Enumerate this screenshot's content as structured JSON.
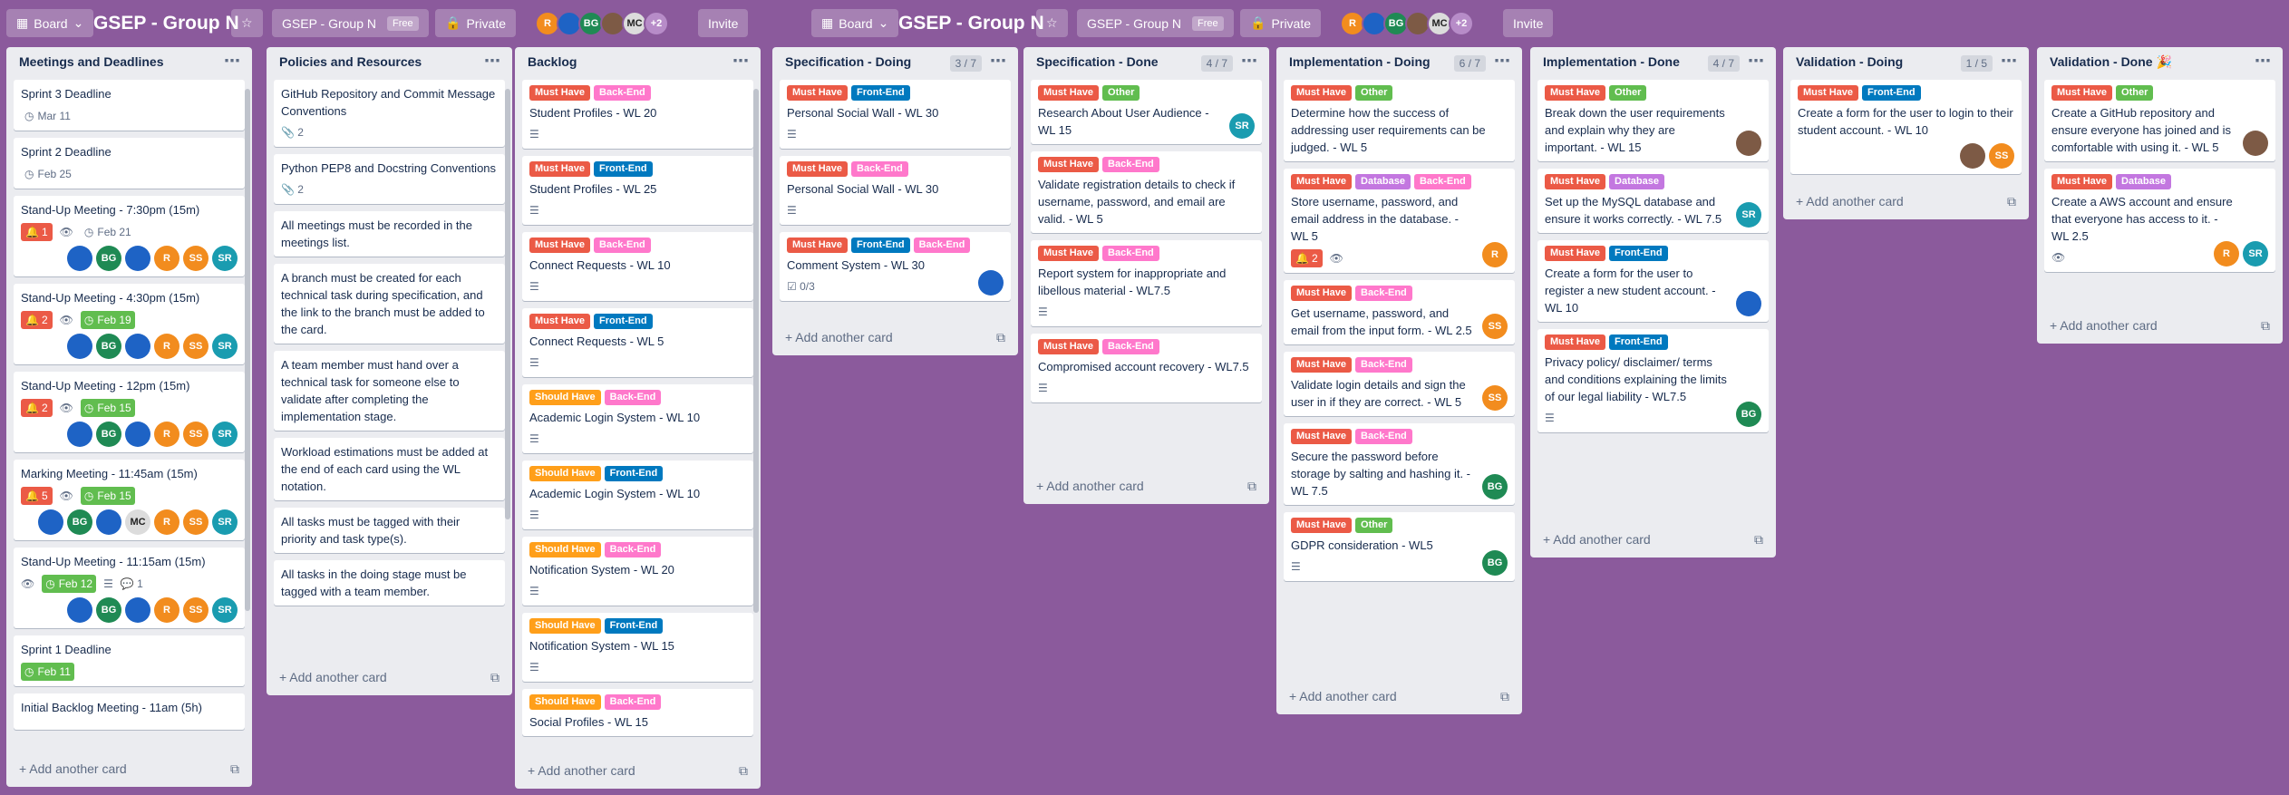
{
  "board": {
    "board_btn": "Board",
    "title": "GSEP - Group N",
    "star_icon": "☆",
    "team": "GSEP - Group N",
    "free": "Free",
    "visibility": "Private",
    "invite": "Invite",
    "more_members": "+2",
    "members": [
      {
        "initials": "R",
        "color": "c-o"
      },
      {
        "initials": "",
        "color": "c-b"
      },
      {
        "initials": "BG",
        "color": "c-g"
      },
      {
        "initials": "",
        "color": "c-p"
      },
      {
        "initials": "MC",
        "color": "c-m"
      }
    ]
  },
  "lists": [
    {
      "title": "Meetings and Deadlines",
      "count": "",
      "add": "Add another card",
      "cards": [
        {
          "title": "Sprint 3 Deadline",
          "badges": [
            {
              "type": "date",
              "text": "Mar 11",
              "style": "plain"
            }
          ]
        },
        {
          "title": "Sprint 2 Deadline",
          "badges": [
            {
              "type": "date",
              "text": "Feb 25",
              "style": "plain"
            }
          ]
        },
        {
          "title": "Stand-Up Meeting - 7:30pm (15m)",
          "badges": [
            {
              "type": "notif",
              "text": "1"
            },
            {
              "type": "watch"
            },
            {
              "type": "date",
              "text": "Feb 21",
              "style": "plain"
            }
          ],
          "members": [
            "",
            "BG",
            "",
            "R",
            "SS",
            "SR"
          ]
        },
        {
          "title": "Stand-Up Meeting - 4:30pm (15m)",
          "badges": [
            {
              "type": "notif",
              "text": "2"
            },
            {
              "type": "watch"
            },
            {
              "type": "date",
              "text": "Feb 19",
              "style": "green"
            }
          ],
          "members": [
            "",
            "BG",
            "",
            "R",
            "SS",
            "SR"
          ]
        },
        {
          "title": "Stand-Up Meeting - 12pm (15m)",
          "badges": [
            {
              "type": "notif",
              "text": "2"
            },
            {
              "type": "watch"
            },
            {
              "type": "date",
              "text": "Feb 15",
              "style": "green"
            }
          ],
          "members": [
            "",
            "BG",
            "",
            "R",
            "SS",
            "SR"
          ]
        },
        {
          "title": "Marking Meeting - 11:45am (15m)",
          "badges": [
            {
              "type": "notif",
              "text": "5"
            },
            {
              "type": "watch"
            },
            {
              "type": "date",
              "text": "Feb 15",
              "style": "green"
            }
          ],
          "members": [
            "",
            "BG",
            "",
            "MC",
            "R",
            "SS",
            "SR"
          ]
        },
        {
          "title": "Stand-Up Meeting - 11:15am (15m)",
          "badges": [
            {
              "type": "watch"
            },
            {
              "type": "date",
              "text": "Feb 12",
              "style": "green"
            },
            {
              "type": "desc"
            },
            {
              "type": "comment",
              "text": "1"
            }
          ],
          "members": [
            "",
            "BG",
            "",
            "R",
            "SS",
            "SR"
          ]
        },
        {
          "title": "Sprint 1 Deadline",
          "badges": [
            {
              "type": "date",
              "text": "Feb 11",
              "style": "green"
            }
          ]
        },
        {
          "title": "Initial Backlog Meeting - 11am (5h)",
          "badges": []
        }
      ]
    },
    {
      "title": "Policies and Resources",
      "count": "",
      "add": "Add another card",
      "cards": [
        {
          "title": "GitHub Repository and Commit Message Conventions",
          "badges": [
            {
              "type": "attach",
              "text": "2"
            }
          ]
        },
        {
          "title": "Python PEP8 and Docstring Conventions",
          "badges": [
            {
              "type": "attach",
              "text": "2"
            }
          ]
        },
        {
          "title": "All meetings must be recorded in the meetings list.",
          "badges": []
        },
        {
          "title": "A branch must be created for each technical task during specification, and the link to the branch must be added to the card.",
          "badges": []
        },
        {
          "title": "A team member must hand over a technical task for someone else to validate after completing the implementation stage.",
          "badges": []
        },
        {
          "title": "Workload estimations must be added at the end of each card using the WL notation.",
          "badges": []
        },
        {
          "title": "All tasks must be tagged with their priority and task type(s).",
          "badges": []
        },
        {
          "title": "All tasks in the doing stage must be tagged with a team member.",
          "badges": []
        }
      ]
    },
    {
      "title": "Backlog",
      "count": "",
      "add": "Add another card",
      "cards": [
        {
          "labels": [
            [
              "Must Have",
              "l-red"
            ],
            [
              "Back-End",
              "l-pink"
            ]
          ],
          "title": "Student Profiles - WL 20",
          "badges": [
            {
              "type": "desc"
            }
          ]
        },
        {
          "labels": [
            [
              "Must Have",
              "l-red"
            ],
            [
              "Front-End",
              "l-blue"
            ]
          ],
          "title": "Student Profiles - WL 25",
          "badges": [
            {
              "type": "desc"
            }
          ]
        },
        {
          "labels": [
            [
              "Must Have",
              "l-red"
            ],
            [
              "Back-End",
              "l-pink"
            ]
          ],
          "title": "Connect Requests - WL 10",
          "badges": [
            {
              "type": "desc"
            }
          ]
        },
        {
          "labels": [
            [
              "Must Have",
              "l-red"
            ],
            [
              "Front-End",
              "l-blue"
            ]
          ],
          "title": "Connect Requests - WL 5",
          "badges": [
            {
              "type": "desc"
            }
          ]
        },
        {
          "labels": [
            [
              "Should Have",
              "l-orange"
            ],
            [
              "Back-End",
              "l-pink"
            ]
          ],
          "title": "Academic Login System - WL 10",
          "badges": [
            {
              "type": "desc"
            }
          ]
        },
        {
          "labels": [
            [
              "Should Have",
              "l-orange"
            ],
            [
              "Front-End",
              "l-blue"
            ]
          ],
          "title": "Academic Login System - WL 10",
          "badges": [
            {
              "type": "desc"
            }
          ]
        },
        {
          "labels": [
            [
              "Should Have",
              "l-orange"
            ],
            [
              "Back-End",
              "l-pink"
            ]
          ],
          "title": "Notification System - WL 20",
          "badges": [
            {
              "type": "desc"
            }
          ]
        },
        {
          "labels": [
            [
              "Should Have",
              "l-orange"
            ],
            [
              "Front-End",
              "l-blue"
            ]
          ],
          "title": "Notification System - WL 15",
          "badges": [
            {
              "type": "desc"
            }
          ]
        },
        {
          "labels": [
            [
              "Should Have",
              "l-orange"
            ],
            [
              "Back-End",
              "l-pink"
            ]
          ],
          "title": "Social Profiles - WL 15",
          "badges": []
        }
      ]
    },
    {
      "title": "Specification - Doing",
      "count": "3 / 7",
      "add": "Add another card",
      "cards": [
        {
          "labels": [
            [
              "Must Have",
              "l-red"
            ],
            [
              "Front-End",
              "l-blue"
            ]
          ],
          "title": "Personal Social Wall - WL 30",
          "badges": [
            {
              "type": "desc"
            }
          ]
        },
        {
          "labels": [
            [
              "Must Have",
              "l-red"
            ],
            [
              "Back-End",
              "l-pink"
            ]
          ],
          "title": "Personal Social Wall - WL 30",
          "badges": [
            {
              "type": "desc"
            }
          ]
        },
        {
          "labels": [
            [
              "Must Have",
              "l-red"
            ],
            [
              "Front-End",
              "l-blue"
            ],
            [
              "Back-End",
              "l-pink"
            ]
          ],
          "title": "Comment System - WL 30",
          "badges": [
            {
              "type": "check",
              "text": "0/3"
            }
          ],
          "members": [
            ""
          ],
          "mright": true
        }
      ]
    },
    {
      "title": "Specification - Done",
      "count": "4 / 7",
      "add": "Add another card",
      "cards": [
        {
          "labels": [
            [
              "Must Have",
              "l-red"
            ],
            [
              "Other",
              "l-green"
            ]
          ],
          "title": "Research About User Audience - WL 15",
          "badges": [],
          "members": [
            "SR"
          ],
          "mright": true
        },
        {
          "labels": [
            [
              "Must Have",
              "l-red"
            ],
            [
              "Back-End",
              "l-pink"
            ]
          ],
          "title": "Validate registration details to check if username, password, and email are valid. - WL 5",
          "badges": []
        },
        {
          "labels": [
            [
              "Must Have",
              "l-red"
            ],
            [
              "Back-End",
              "l-pink"
            ]
          ],
          "title": "Report system for inappropriate and libellous material - WL7.5",
          "badges": [
            {
              "type": "desc"
            }
          ]
        },
        {
          "labels": [
            [
              "Must Have",
              "l-red"
            ],
            [
              "Back-End",
              "l-pink"
            ]
          ],
          "title": "Compromised account recovery - WL7.5",
          "badges": [
            {
              "type": "desc"
            }
          ]
        }
      ]
    },
    {
      "title": "Implementation - Doing",
      "count": "6 / 7",
      "add": "Add another card",
      "cards": [
        {
          "labels": [
            [
              "Must Have",
              "l-red"
            ],
            [
              "Other",
              "l-green"
            ]
          ],
          "title": "Determine how the success of addressing user requirements can be judged. - WL 5",
          "badges": []
        },
        {
          "labels": [
            [
              "Must Have",
              "l-red"
            ],
            [
              "Database",
              "l-purple"
            ],
            [
              "Back-End",
              "l-pink"
            ]
          ],
          "title": "Store username, password, and email address in the database. - WL 5",
          "badges": [
            {
              "type": "notif",
              "text": "2"
            },
            {
              "type": "watch"
            }
          ],
          "members": [
            "R"
          ],
          "mright": true
        },
        {
          "labels": [
            [
              "Must Have",
              "l-red"
            ],
            [
              "Back-End",
              "l-pink"
            ]
          ],
          "title": "Get username, password, and email from the input form. - WL 2.5",
          "badges": [],
          "members": [
            "SS"
          ],
          "mright": true
        },
        {
          "labels": [
            [
              "Must Have",
              "l-red"
            ],
            [
              "Back-End",
              "l-pink"
            ]
          ],
          "title": "Validate login details and sign the user in if they are correct. - WL 5",
          "badges": [],
          "members": [
            "SS"
          ],
          "mright": true
        },
        {
          "labels": [
            [
              "Must Have",
              "l-red"
            ],
            [
              "Back-End",
              "l-pink"
            ]
          ],
          "title": "Secure the password before storage by salting and hashing it. - WL 7.5",
          "badges": [],
          "members": [
            "BG"
          ],
          "mright": true
        },
        {
          "labels": [
            [
              "Must Have",
              "l-red"
            ],
            [
              "Other",
              "l-green"
            ]
          ],
          "title": "GDPR consideration - WL5",
          "badges": [
            {
              "type": "desc"
            }
          ],
          "members": [
            "BG"
          ],
          "mright": true
        }
      ]
    },
    {
      "title": "Implementation - Done",
      "count": "4 / 7",
      "add": "Add another card",
      "cards": [
        {
          "labels": [
            [
              "Must Have",
              "l-red"
            ],
            [
              "Other",
              "l-green"
            ]
          ],
          "title": "Break down the user requirements and explain why they are important. - WL 15",
          "badges": [],
          "members": [
            "pic"
          ],
          "mright": true
        },
        {
          "labels": [
            [
              "Must Have",
              "l-red"
            ],
            [
              "Database",
              "l-purple"
            ]
          ],
          "title": "Set up the MySQL database and ensure it works correctly. - WL 7.5",
          "badges": [],
          "members": [
            "SR"
          ],
          "mright": true
        },
        {
          "labels": [
            [
              "Must Have",
              "l-red"
            ],
            [
              "Front-End",
              "l-blue"
            ]
          ],
          "title": "Create a form for the user to register a new student account. - WL 10",
          "badges": [],
          "members": [
            ""
          ],
          "mright": true
        },
        {
          "labels": [
            [
              "Must Have",
              "l-red"
            ],
            [
              "Front-End",
              "l-blue"
            ]
          ],
          "title": "Privacy policy/ disclaimer/ terms and conditions explaining the limits of our legal liability - WL7.5",
          "badges": [
            {
              "type": "desc"
            }
          ],
          "members": [
            "BG"
          ],
          "mright": true
        }
      ]
    },
    {
      "title": "Validation - Doing",
      "count": "1 / 5",
      "add": "Add another card",
      "cards": [
        {
          "labels": [
            [
              "Must Have",
              "l-red"
            ],
            [
              "Front-End",
              "l-blue"
            ]
          ],
          "title": "Create a form for the user to login to their student account. - WL 10",
          "badges": [],
          "members": [
            "pic",
            "SS"
          ]
        }
      ]
    },
    {
      "title": "Validation - Done 🎉",
      "count": "",
      "add": "Add another card",
      "cards": [
        {
          "labels": [
            [
              "Must Have",
              "l-red"
            ],
            [
              "Other",
              "l-green"
            ]
          ],
          "title": "Create a GitHub repository and ensure everyone has joined and is comfortable with using it. - WL 5",
          "badges": [],
          "members": [
            "pic"
          ],
          "mright": true
        },
        {
          "labels": [
            [
              "Must Have",
              "l-red"
            ],
            [
              "Database",
              "l-purple"
            ]
          ],
          "title": "Create a AWS account and ensure that everyone has access to it. - WL 2.5",
          "badges": [
            {
              "type": "watch"
            }
          ],
          "members": [
            "R",
            "SR"
          ],
          "mright": true
        }
      ]
    }
  ]
}
